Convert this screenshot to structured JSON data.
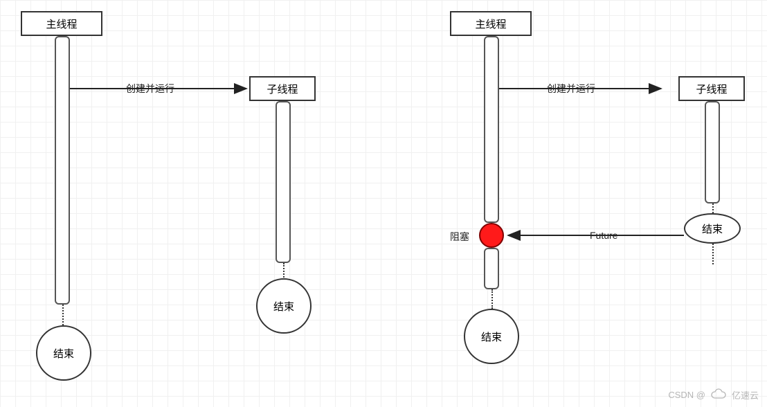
{
  "left": {
    "main_thread": "主线程",
    "child_thread": "子线程",
    "create_run": "创建并运行",
    "end_main": "结束",
    "end_child": "结束"
  },
  "right": {
    "main_thread": "主线程",
    "child_thread": "子线程",
    "create_run": "创建并运行",
    "block": "阻塞",
    "future": "Future",
    "end_main": "结束",
    "end_child": "结束"
  },
  "watermark": {
    "csdn": "CSDN @",
    "brand": "亿速云"
  }
}
